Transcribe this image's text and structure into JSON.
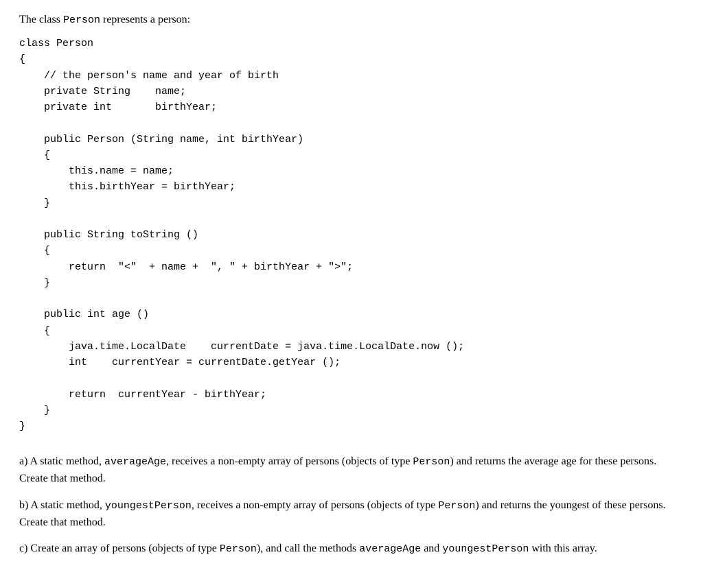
{
  "intro": {
    "prefix": "The class ",
    "classname": "Person",
    "suffix": " represents a person:"
  },
  "code": "class Person\n{\n    // the person's name and year of birth\n    private String    name;\n    private int       birthYear;\n\n    public Person (String name, int birthYear)\n    {\n        this.name = name;\n        this.birthYear = birthYear;\n    }\n\n    public String toString ()\n    {\n        return  \"<\"  + name +  \", \" + birthYear + \">\";\n    }\n\n    public int age ()\n    {\n        java.time.LocalDate    currentDate = java.time.LocalDate.now ();\n        int    currentYear = currentDate.getYear ();\n\n        return  currentYear - birthYear;\n    }\n}",
  "questions": {
    "a": {
      "t1": "a) A static method, ",
      "m1": "averageAge",
      "t2": ", receives a non-empty array of persons (objects of type ",
      "m2": "Person",
      "t3": ") and returns the average age for these persons. Create that method."
    },
    "b": {
      "t1": "b) A static method, ",
      "m1": "youngestPerson",
      "t2": ", receives a non-empty array of persons (objects of type ",
      "m2": "Person",
      "t3": ") and returns the youngest of these persons. Create that method."
    },
    "c": {
      "t1": "c) Create an array of persons (objects of type ",
      "m1": "Person",
      "t2": "), and call the methods ",
      "m2": "averageAge",
      "t3": " and ",
      "m3": "youngestPerson",
      "t4": " with this array."
    }
  }
}
